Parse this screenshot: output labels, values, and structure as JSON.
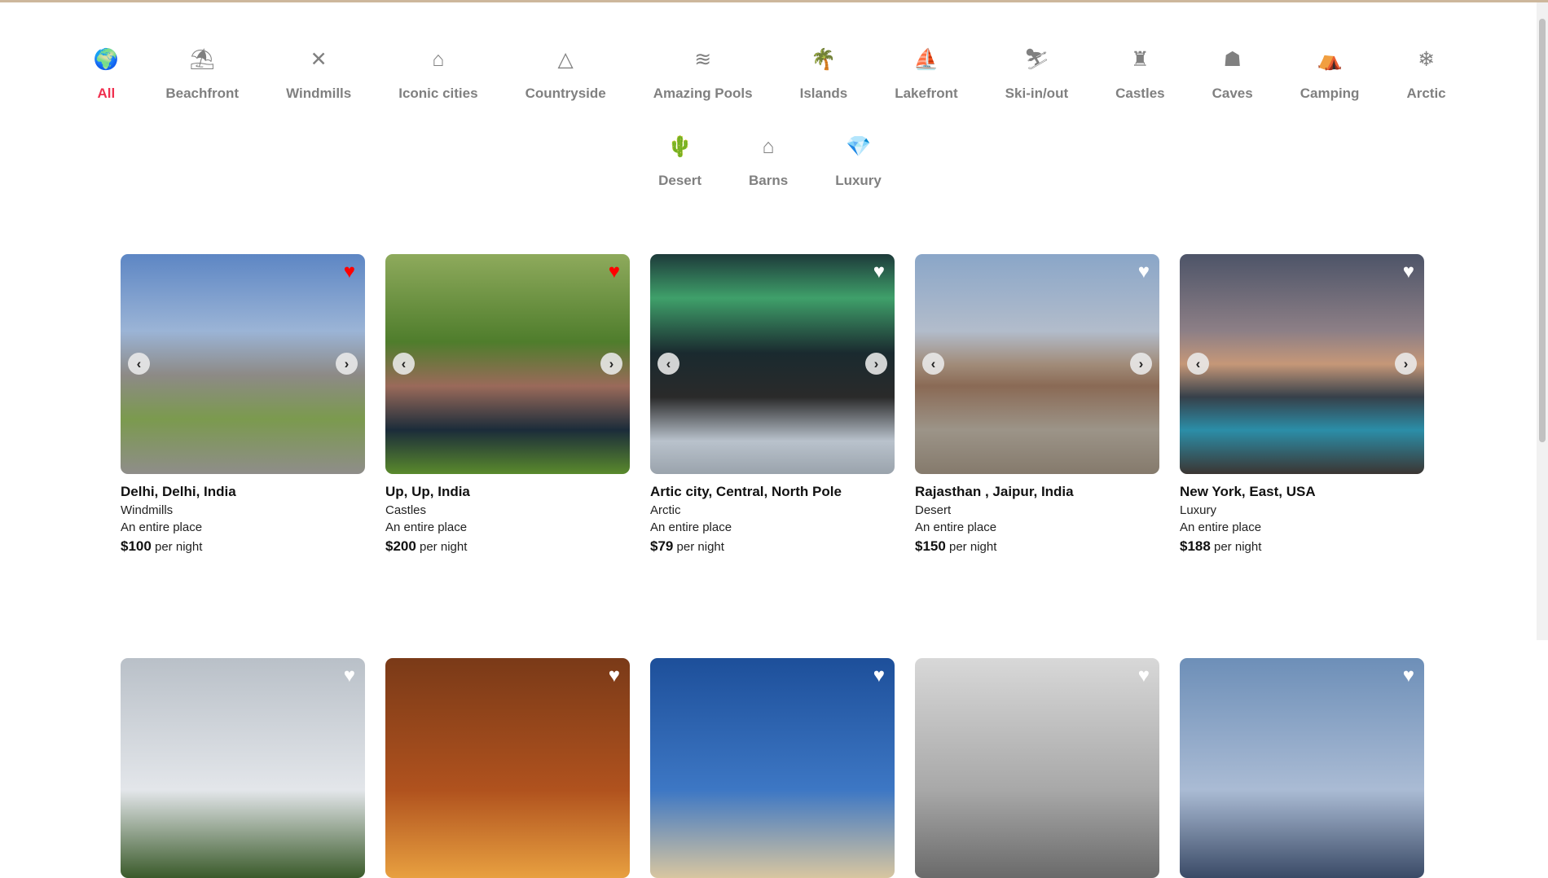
{
  "categories": [
    {
      "label": "All",
      "icon": "globe-icon",
      "glyph": "🌍",
      "active": true
    },
    {
      "label": "Beachfront",
      "icon": "beach-umbrella-icon",
      "glyph": "⛱"
    },
    {
      "label": "Windmills",
      "icon": "windmill-icon",
      "glyph": "✕"
    },
    {
      "label": "Iconic cities",
      "icon": "city-building-icon",
      "glyph": "⌂"
    },
    {
      "label": "Countryside",
      "icon": "mountain-icon",
      "glyph": "△"
    },
    {
      "label": "Amazing Pools",
      "icon": "pool-ladder-icon",
      "glyph": "≋"
    },
    {
      "label": "Islands",
      "icon": "palm-island-icon",
      "glyph": "🌴"
    },
    {
      "label": "Lakefront",
      "icon": "fishing-boat-icon",
      "glyph": "⛵"
    },
    {
      "label": "Ski-in/out",
      "icon": "skier-icon",
      "glyph": "⛷"
    },
    {
      "label": "Castles",
      "icon": "castle-icon",
      "glyph": "♜"
    },
    {
      "label": "Caves",
      "icon": "cave-icon",
      "glyph": "☗"
    },
    {
      "label": "Camping",
      "icon": "camping-tent-icon",
      "glyph": "⛺"
    },
    {
      "label": "Arctic",
      "icon": "snowflake-icon",
      "glyph": "❄"
    },
    {
      "label": "Desert",
      "icon": "cactus-icon",
      "glyph": "🌵"
    },
    {
      "label": "Barns",
      "icon": "barn-icon",
      "glyph": "⌂"
    },
    {
      "label": "Luxury",
      "icon": "diamond-icon",
      "glyph": "💎"
    }
  ],
  "listings": [
    {
      "title": "Delhi, Delhi, India",
      "category": "Windmills",
      "type": "An entire place",
      "price": "$100",
      "per": "per night",
      "favorited": true,
      "bg": "linear-gradient(180deg,#5d86c4 0%,#9bb4d6 35%,#8d8a86 55%,#7b9a4e 75%,#8f8d8a 100%)"
    },
    {
      "title": "Up, Up, India",
      "category": "Castles",
      "type": "An entire place",
      "price": "$200",
      "per": "per night",
      "favorited": true,
      "bg": "linear-gradient(180deg,#8eaa5c 0%,#4f7d2c 40%,#9a6a5a 60%,#1b2c3a 80%,#5a8a2c 100%)"
    },
    {
      "title": "Artic city, Central, North Pole",
      "category": "Arctic",
      "type": "An entire place",
      "price": "$79",
      "per": "per night",
      "favorited": false,
      "bg": "linear-gradient(180deg,#1d3a3a 0%,#3fa06a 20%,#1a2a2f 45%,#2a2a2a 65%,#b9c2cc 85%,#9aa3ac 100%)"
    },
    {
      "title": "Rajasthan , Jaipur, India",
      "category": "Desert",
      "type": "An entire place",
      "price": "$150",
      "per": "per night",
      "favorited": false,
      "bg": "linear-gradient(180deg,#8aa6c8 0%,#b2bccb 35%,#a18c7a 50%,#8a6a55 60%,#9c9488 80%,#857a6c 100%)"
    },
    {
      "title": "New York, East, USA",
      "category": "Luxury",
      "type": "An entire place",
      "price": "$188",
      "per": "per night",
      "favorited": false,
      "bg": "linear-gradient(180deg,#4d5468 0%,#8d7f86 35%,#c59778 50%,#36404a 65%,#2b8ea8 80%,#3b3532 100%)"
    },
    {
      "favorited": false,
      "bg": "linear-gradient(180deg,#b9c0c8,#e3e6ea 60%,#3a5a2a)"
    },
    {
      "favorited": false,
      "bg": "linear-gradient(180deg,#7a3a18,#b0521e 60%,#e8a040)"
    },
    {
      "favorited": false,
      "bg": "linear-gradient(180deg,#1d4f9a,#3d77c4 60%,#d8c6a0)"
    },
    {
      "favorited": false,
      "bg": "linear-gradient(180deg,#d8d8d8,#a8a8a8 60%,#6a6a6a)"
    },
    {
      "favorited": false,
      "bg": "linear-gradient(180deg,#6d8fb8,#aabbd4 60%,#3a4a66)"
    }
  ],
  "colors": {
    "accent": "#f0304f",
    "heart_fav": "#ff0000",
    "heart": "#ffffff"
  }
}
